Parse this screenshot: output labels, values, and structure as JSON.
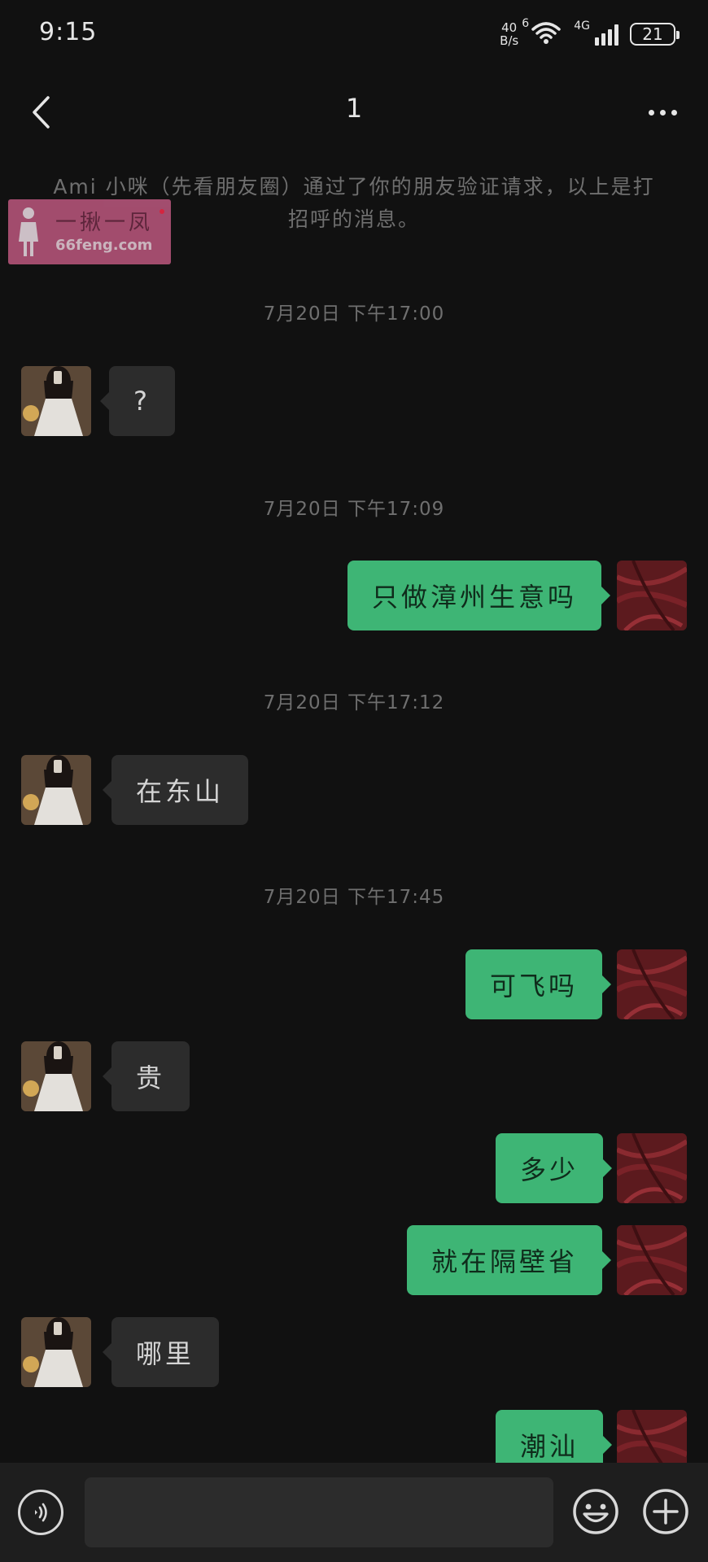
{
  "status_bar": {
    "time": "9:15",
    "net_speed_value": "40",
    "net_speed_unit": "B/s",
    "wifi_tag": "6",
    "lte_tag": "4G",
    "battery": "21"
  },
  "header": {
    "title": "1",
    "back_icon": "chevron-left-icon",
    "more_icon": "more-dots-icon"
  },
  "system_notice": "Ami 小咪（先看朋友圈）通过了你的朋友验证请求，以上是打招呼的消息。",
  "watermark": {
    "title": "一揪一凤",
    "site": "66feng.com"
  },
  "timestamps": [
    "7月20日 下午17:00",
    "7月20日 下午17:09",
    "7月20日 下午17:12",
    "7月20日 下午17:45"
  ],
  "messages": [
    {
      "from": "contact",
      "text": "?"
    },
    {
      "from": "me",
      "text": "只做漳州生意吗"
    },
    {
      "from": "contact",
      "text": "在东山"
    },
    {
      "from": "me",
      "text": "可飞吗"
    },
    {
      "from": "contact",
      "text": "贵"
    },
    {
      "from": "me",
      "text": "多少"
    },
    {
      "from": "me",
      "text": "就在隔壁省"
    },
    {
      "from": "contact",
      "text": "哪里"
    },
    {
      "from": "me",
      "text": "潮汕"
    }
  ],
  "input_bar": {
    "message_value": "",
    "voice_icon": "voice-icon",
    "emoji_icon": "emoji-icon",
    "plus_icon": "plus-circle-icon"
  },
  "colors": {
    "background": "#111111",
    "incoming_bubble": "#2c2c2c",
    "outgoing_bubble": "#3eb575",
    "meta_text": "#6f6f6f"
  }
}
